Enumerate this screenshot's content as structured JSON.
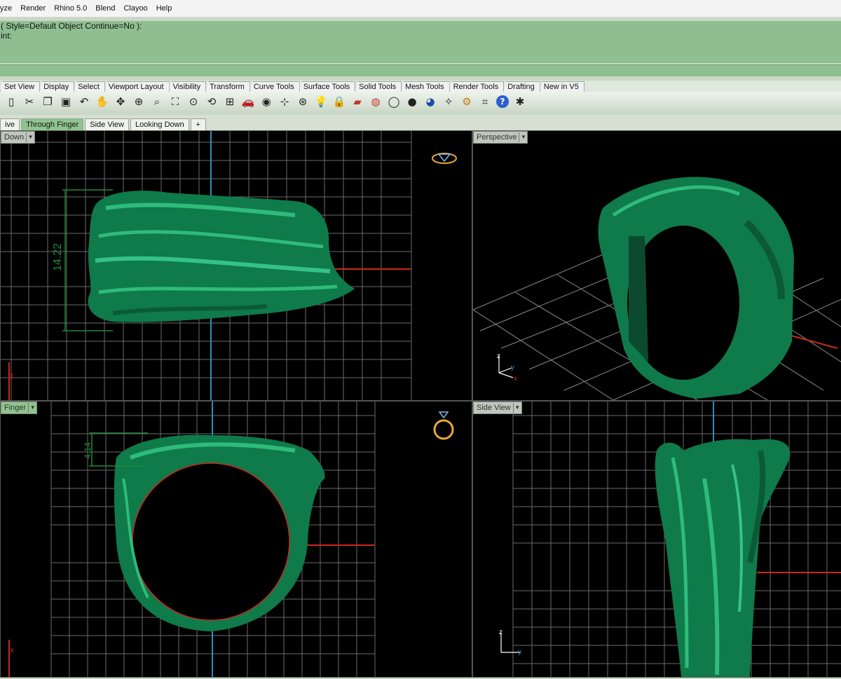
{
  "menu": [
    "yze",
    "Render",
    "Rhino 5.0",
    "Blend",
    "Clayoo",
    "Help"
  ],
  "command": {
    "line1": "( Style=Default  Object  Continue=No ):",
    "line2": "int:"
  },
  "toolbar_tabs": [
    "Set View",
    "Display",
    "Select",
    "Viewport Layout",
    "Visibility",
    "Transform",
    "Curve Tools",
    "Surface Tools",
    "Solid Tools",
    "Mesh Tools",
    "Render Tools",
    "Drafting",
    "New in V5"
  ],
  "toolbar_icons": [
    "new-icon",
    "cut-icon",
    "copy-icon",
    "paste-icon",
    "undo-icon",
    "pan-hand-icon",
    "move-icon",
    "zoom-in-icon",
    "zoom-window-icon",
    "zoom-extents-icon",
    "zoom-selected-icon",
    "rotate-view-icon",
    "four-viewports-icon",
    "car-icon",
    "hide-icon",
    "snap-icon",
    "osnap-icon",
    "light-icon",
    "lock-icon",
    "layer-icon",
    "color-wheel-icon",
    "wireframe-icon",
    "shaded-icon",
    "rendered-icon",
    "render-icon",
    "settings-icon",
    "crop-icon",
    "help-icon",
    "tools-icon"
  ],
  "viewport_tabs": [
    "ive",
    "Through Finger",
    "Side View",
    "Looking Down",
    "+"
  ],
  "viewports": {
    "top_left": {
      "label": "Down",
      "dimension": "14.22"
    },
    "top_right": {
      "label": "Perspective",
      "axis": {
        "z": "z",
        "y": "y",
        "x": "x"
      }
    },
    "bottom_left": {
      "label": "Finger",
      "dimension": "4.14"
    },
    "bottom_right": {
      "label": "Side View",
      "axis": {
        "z": "z",
        "y": "y"
      }
    }
  },
  "axis_x": "x",
  "colors": {
    "command_bg": "#8fbf90",
    "ring_green": "#0f7a4a",
    "grid": "#6e6e6e",
    "axis_blue": "#2a8fc0",
    "axis_red": "#c8281e"
  }
}
